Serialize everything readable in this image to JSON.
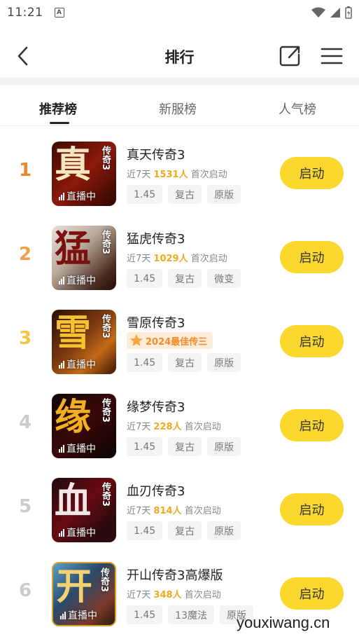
{
  "status": {
    "time": "11:21",
    "badge": "A"
  },
  "header": {
    "title": "排行"
  },
  "tabs": [
    {
      "label": "推荐榜"
    },
    {
      "label": "新服榜"
    },
    {
      "label": "人气榜"
    }
  ],
  "colors": {
    "accent": "#fbd82d",
    "rank1": "#e88a2a",
    "rank2": "#eda24a",
    "rank3": "#f5c542",
    "rank_other": "#cccccc",
    "count": "#f2a91d"
  },
  "list": [
    {
      "rank": "1",
      "name": "真天传奇3",
      "meta_prefix": "近7天",
      "count": "1531人",
      "meta_suffix": "首次启动",
      "tags": [
        "1.45",
        "复古",
        "原版"
      ],
      "thumb_text": "真",
      "thumb_small": "传奇3",
      "live": "直播中",
      "button": "启动"
    },
    {
      "rank": "2",
      "name": "猛虎传奇3",
      "meta_prefix": "近7天",
      "count": "1029人",
      "meta_suffix": "首次启动",
      "tags": [
        "1.45",
        "复古",
        "微变"
      ],
      "thumb_text": "猛",
      "thumb_small": "传奇3",
      "live": "直播中",
      "button": "启动"
    },
    {
      "rank": "3",
      "name": "雪原传奇3",
      "award": "2024最佳传三",
      "tags": [
        "1.45",
        "复古",
        "原版"
      ],
      "thumb_text": "雪",
      "thumb_small": "传奇3",
      "live": "直播中",
      "button": "启动"
    },
    {
      "rank": "4",
      "name": "缘梦传奇3",
      "meta_prefix": "近7天",
      "count": "228人",
      "meta_suffix": "首次启动",
      "tags": [
        "1.45",
        "复古",
        "原版"
      ],
      "thumb_text": "缘",
      "thumb_small": "传奇3",
      "live": "直播中",
      "button": "启动"
    },
    {
      "rank": "5",
      "name": "血刃传奇3",
      "meta_prefix": "近7天",
      "count": "814人",
      "meta_suffix": "首次启动",
      "tags": [
        "1.45",
        "复古",
        "原版"
      ],
      "thumb_text": "血",
      "thumb_small": "传奇3",
      "live": "直播中",
      "button": "启动"
    },
    {
      "rank": "6",
      "name": "开山传奇3高爆版",
      "meta_prefix": "近7天",
      "count": "348人",
      "meta_suffix": "首次启动",
      "tags": [
        "1.45",
        "13魔法",
        "原版"
      ],
      "thumb_text": "开",
      "thumb_small": "传奇3",
      "live": "直播中",
      "button": "启动"
    }
  ],
  "watermark": "youxiwang.cn"
}
